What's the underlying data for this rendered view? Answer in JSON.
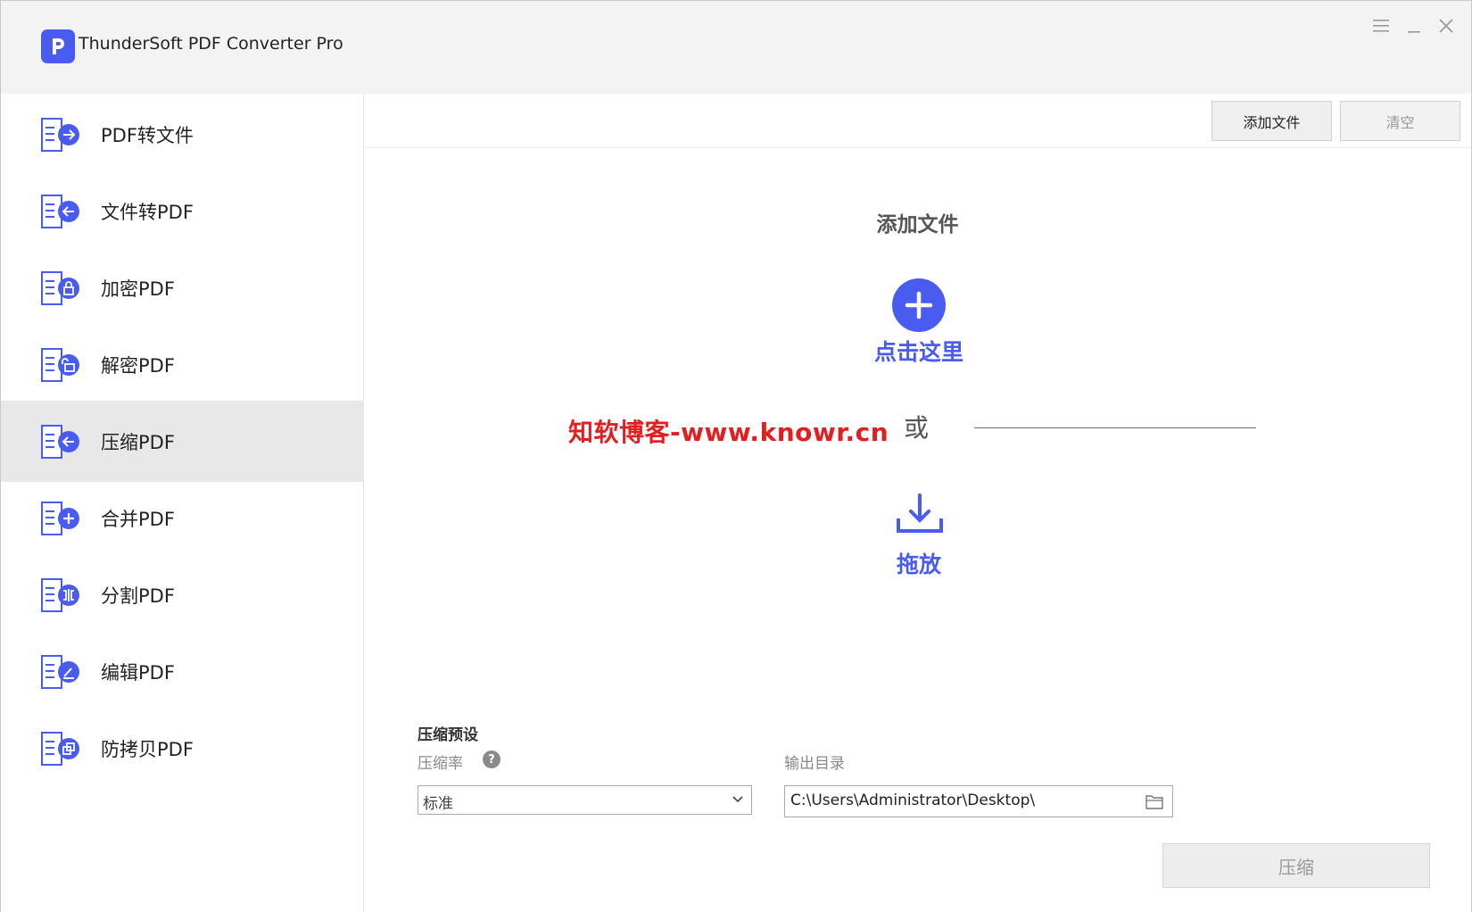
{
  "app": {
    "title": "ThunderSoft PDF Converter Pro",
    "accent_color": "#4a5cf0",
    "window_controls": [
      "menu-icon",
      "minimize-icon",
      "close-icon"
    ]
  },
  "sidebar": {
    "active_index": 4,
    "items": [
      {
        "label": "PDF转文件",
        "icon": "pdf-to-file-icon"
      },
      {
        "label": "文件转PDF",
        "icon": "file-to-pdf-icon"
      },
      {
        "label": "加密PDF",
        "icon": "lock-icon"
      },
      {
        "label": "解密PDF",
        "icon": "unlock-icon"
      },
      {
        "label": "压缩PDF",
        "icon": "compress-icon"
      },
      {
        "label": "合并PDF",
        "icon": "merge-icon"
      },
      {
        "label": "分割PDF",
        "icon": "split-icon"
      },
      {
        "label": "编辑PDF",
        "icon": "edit-icon"
      },
      {
        "label": "防拷贝PDF",
        "icon": "copy-protect-icon"
      }
    ]
  },
  "toolbar": {
    "add_file_label": "添加文件",
    "clear_label": "清空"
  },
  "dropzone": {
    "title": "添加文件",
    "click_here": "点击这里",
    "or": "或",
    "drag": "拖放",
    "watermark": "知软博客-www.knowr.cn"
  },
  "settings": {
    "preset_title": "压缩预设",
    "rate_label": "压缩率",
    "help": "?",
    "rate_value": "标准",
    "output_label": "输出目录",
    "output_path": "C:\\Users\\Administrator\\Desktop\\"
  },
  "actions": {
    "compress_label": "压缩"
  }
}
